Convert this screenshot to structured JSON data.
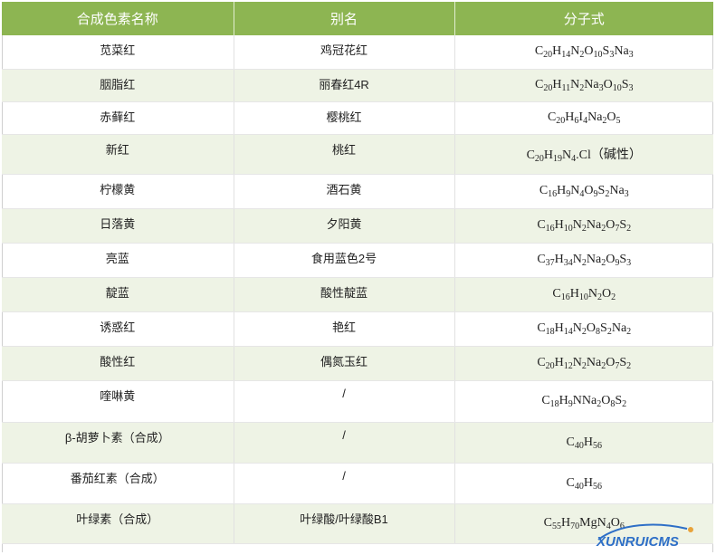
{
  "table": {
    "headers": [
      "合成色素名称",
      "别名",
      "分子式"
    ],
    "rows": [
      {
        "name": "苋菜红",
        "alias": "鸡冠花红",
        "formula": [
          [
            "C",
            ""
          ],
          [
            "20",
            "s"
          ],
          [
            "H",
            ""
          ],
          [
            "14",
            "s"
          ],
          [
            "N",
            ""
          ],
          [
            "2",
            "s"
          ],
          [
            "O",
            ""
          ],
          [
            "10",
            "s"
          ],
          [
            "S",
            ""
          ],
          [
            "3",
            "s"
          ],
          [
            "Na",
            ""
          ],
          [
            "3",
            "s"
          ]
        ]
      },
      {
        "name": "胭脂红",
        "alias": "丽春红4R",
        "formula": [
          [
            "C",
            ""
          ],
          [
            "20",
            "s"
          ],
          [
            "H",
            ""
          ],
          [
            "11",
            "s"
          ],
          [
            "N",
            ""
          ],
          [
            "2",
            "s"
          ],
          [
            "Na",
            ""
          ],
          [
            "3",
            "s"
          ],
          [
            "O",
            ""
          ],
          [
            "10",
            "s"
          ],
          [
            "S",
            ""
          ],
          [
            "3",
            "s"
          ]
        ]
      },
      {
        "name": "赤藓红",
        "alias": "樱桃红",
        "formula": [
          [
            "C",
            ""
          ],
          [
            "20",
            "s"
          ],
          [
            "H",
            ""
          ],
          [
            "6",
            "s"
          ],
          [
            "I",
            ""
          ],
          [
            "4",
            "s"
          ],
          [
            "Na",
            ""
          ],
          [
            "2",
            "s"
          ],
          [
            "O",
            ""
          ],
          [
            "5",
            "s"
          ]
        ]
      },
      {
        "name": "新红",
        "alias": "桃红",
        "formula": [
          [
            "C",
            ""
          ],
          [
            "20",
            "s"
          ],
          [
            "H",
            ""
          ],
          [
            "19",
            "s"
          ],
          [
            "N",
            ""
          ],
          [
            "4",
            "s"
          ],
          [
            ".Cl（碱性）",
            ""
          ]
        ]
      },
      {
        "name": "柠檬黄",
        "alias": "酒石黄",
        "formula": [
          [
            "C",
            ""
          ],
          [
            "16",
            "s"
          ],
          [
            "H",
            ""
          ],
          [
            "9",
            "s"
          ],
          [
            "N",
            ""
          ],
          [
            "4",
            "s"
          ],
          [
            "O",
            ""
          ],
          [
            "9",
            "s"
          ],
          [
            "S",
            ""
          ],
          [
            "2",
            "s"
          ],
          [
            "Na",
            ""
          ],
          [
            "3",
            "s"
          ]
        ]
      },
      {
        "name": "日落黄",
        "alias": "夕阳黄",
        "formula": [
          [
            "C",
            ""
          ],
          [
            "16",
            "s"
          ],
          [
            "H",
            ""
          ],
          [
            "10",
            "s"
          ],
          [
            "N",
            ""
          ],
          [
            "2",
            "s"
          ],
          [
            "Na",
            ""
          ],
          [
            "2",
            "s"
          ],
          [
            "O",
            ""
          ],
          [
            "7",
            "s"
          ],
          [
            "S",
            ""
          ],
          [
            "2",
            "s"
          ]
        ]
      },
      {
        "name": "亮蓝",
        "alias": "食用蓝色2号",
        "formula": [
          [
            "C",
            ""
          ],
          [
            "37",
            "s"
          ],
          [
            "H",
            ""
          ],
          [
            "34",
            "s"
          ],
          [
            "N",
            ""
          ],
          [
            "2",
            "s"
          ],
          [
            "Na",
            ""
          ],
          [
            "2",
            "s"
          ],
          [
            "O",
            ""
          ],
          [
            "9",
            "s"
          ],
          [
            "S",
            ""
          ],
          [
            "3",
            "s"
          ]
        ]
      },
      {
        "name": "靛蓝",
        "alias": "酸性靛蓝",
        "formula": [
          [
            "C",
            ""
          ],
          [
            "16",
            "s"
          ],
          [
            "H",
            ""
          ],
          [
            "10",
            "s"
          ],
          [
            "N",
            ""
          ],
          [
            "2",
            "s"
          ],
          [
            "O",
            ""
          ],
          [
            "2",
            "s"
          ]
        ]
      },
      {
        "name": "诱惑红",
        "alias": "艳红",
        "formula": [
          [
            "C",
            ""
          ],
          [
            "18",
            "s"
          ],
          [
            "H",
            ""
          ],
          [
            "14",
            "s"
          ],
          [
            "N",
            ""
          ],
          [
            "2",
            "s"
          ],
          [
            "O",
            ""
          ],
          [
            "8",
            "s"
          ],
          [
            "S",
            ""
          ],
          [
            "2",
            "s"
          ],
          [
            "Na",
            ""
          ],
          [
            "2",
            "s"
          ]
        ]
      },
      {
        "name": "酸性红",
        "alias": "偶氮玉红",
        "formula": [
          [
            "C",
            ""
          ],
          [
            "20",
            "s"
          ],
          [
            "H",
            ""
          ],
          [
            "12",
            "s"
          ],
          [
            "N",
            ""
          ],
          [
            "2",
            "s"
          ],
          [
            "Na",
            ""
          ],
          [
            "2",
            "s"
          ],
          [
            "O",
            ""
          ],
          [
            "7",
            "s"
          ],
          [
            "S",
            ""
          ],
          [
            "2",
            "s"
          ]
        ]
      },
      {
        "name": "喹啉黄",
        "alias": "/",
        "formula": [
          [
            "C",
            ""
          ],
          [
            "18",
            "s"
          ],
          [
            "H",
            ""
          ],
          [
            "9",
            "s"
          ],
          [
            "NNa",
            ""
          ],
          [
            "2",
            "s"
          ],
          [
            "O",
            ""
          ],
          [
            "8",
            "s"
          ],
          [
            "S",
            ""
          ],
          [
            "2",
            "s"
          ]
        ]
      },
      {
        "name": "β-胡萝卜素（合成）",
        "alias": "/",
        "formula": [
          [
            "C",
            ""
          ],
          [
            "40",
            "s"
          ],
          [
            "H",
            ""
          ],
          [
            "56",
            "s"
          ]
        ]
      },
      {
        "name": "番茄红素（合成）",
        "alias": "/",
        "formula": [
          [
            "C",
            ""
          ],
          [
            "40",
            "s"
          ],
          [
            "H",
            ""
          ],
          [
            "56",
            "s"
          ]
        ]
      },
      {
        "name": "叶绿素（合成）",
        "alias": "叶绿酸/叶绿酸B1",
        "formula": [
          [
            "C",
            ""
          ],
          [
            "55",
            "s"
          ],
          [
            "H",
            ""
          ],
          [
            "70",
            "s"
          ],
          [
            "MgN",
            ""
          ],
          [
            "4",
            "s"
          ],
          [
            "O",
            ""
          ],
          [
            "6",
            "s"
          ]
        ]
      }
    ]
  },
  "watermark": {
    "text": "XUNRUICMS",
    "color": "#2e6fc7"
  },
  "colors": {
    "header_bg": "#8db552",
    "alt_row_bg": "#eef3e5"
  }
}
